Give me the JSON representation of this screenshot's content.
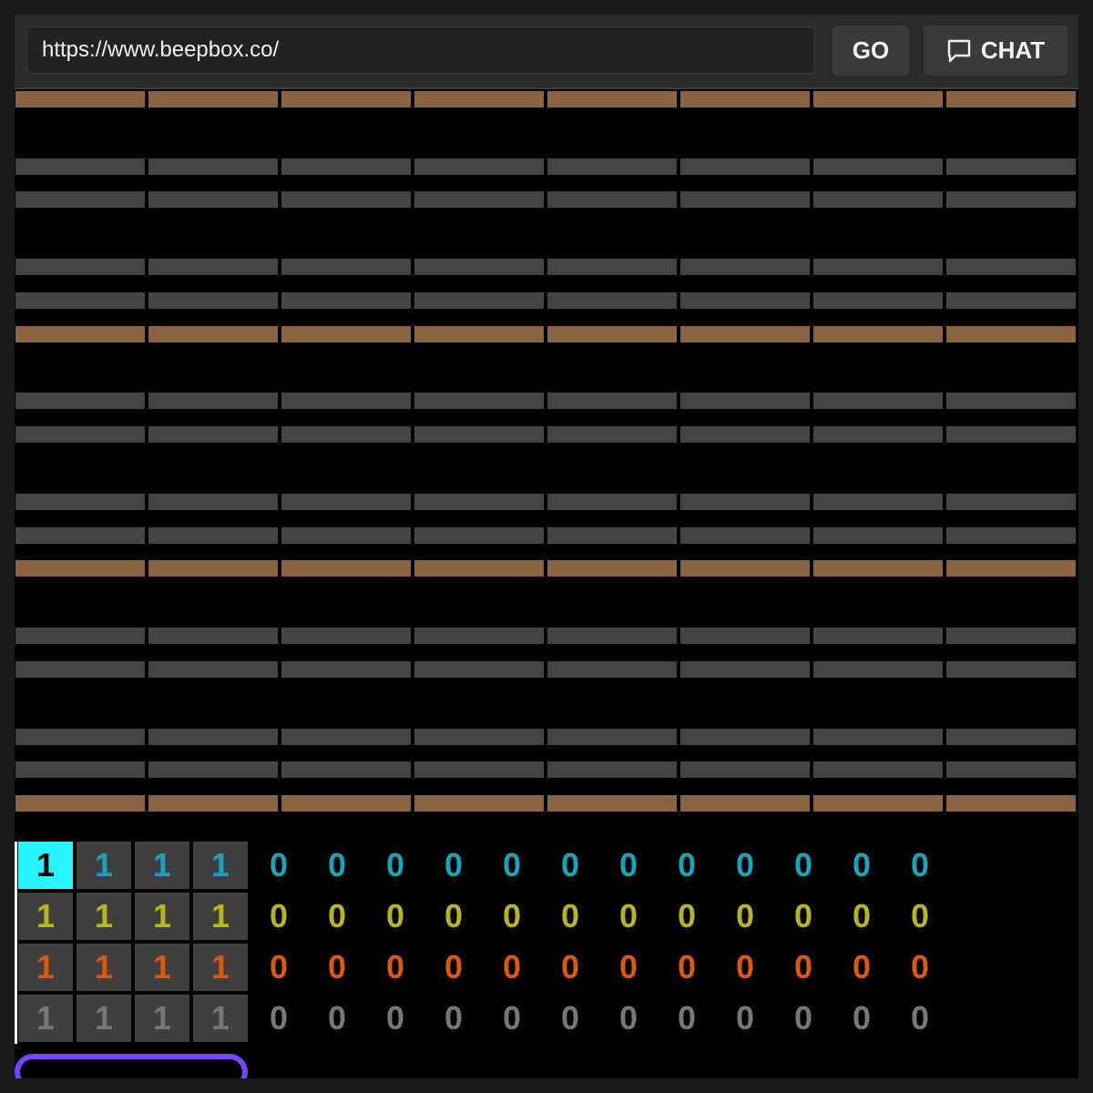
{
  "browser": {
    "url_value": "https://www.beepbox.co/",
    "go_label": "GO",
    "chat_label": "CHAT",
    "chat_icon": "speech-bubble-icon"
  },
  "pattern_editor": {
    "rows": [
      {
        "kind": "accent"
      },
      {
        "kind": "empty"
      },
      {
        "kind": "gray"
      },
      {
        "kind": "gray"
      },
      {
        "kind": "empty"
      },
      {
        "kind": "gray"
      },
      {
        "kind": "gray"
      },
      {
        "kind": "accent"
      },
      {
        "kind": "empty"
      },
      {
        "kind": "gray"
      },
      {
        "kind": "gray"
      },
      {
        "kind": "empty"
      },
      {
        "kind": "gray"
      },
      {
        "kind": "gray"
      },
      {
        "kind": "accent"
      },
      {
        "kind": "empty"
      },
      {
        "kind": "gray"
      },
      {
        "kind": "gray"
      },
      {
        "kind": "empty"
      },
      {
        "kind": "gray"
      },
      {
        "kind": "gray"
      },
      {
        "kind": "accent"
      }
    ],
    "bars_per_row": 8,
    "colors": {
      "gray": "#444444",
      "accent": "#8a6440"
    }
  },
  "track_editor": {
    "selected": {
      "channel": 0,
      "bar": 0
    },
    "channels": [
      {
        "color": "#1aa3b8",
        "cells": [
          "1",
          "1",
          "1",
          "1",
          "0",
          "0",
          "0",
          "0",
          "0",
          "0",
          "0",
          "0",
          "0",
          "0",
          "0",
          "0"
        ]
      },
      {
        "color": "#b5b51e",
        "cells": [
          "1",
          "1",
          "1",
          "1",
          "0",
          "0",
          "0",
          "0",
          "0",
          "0",
          "0",
          "0",
          "0",
          "0",
          "0",
          "0"
        ]
      },
      {
        "color": "#d9590f",
        "cells": [
          "1",
          "1",
          "1",
          "1",
          "0",
          "0",
          "0",
          "0",
          "0",
          "0",
          "0",
          "0",
          "0",
          "0",
          "0",
          "0"
        ]
      },
      {
        "color": "#777777",
        "cells": [
          "1",
          "1",
          "1",
          "1",
          "0",
          "0",
          "0",
          "0",
          "0",
          "0",
          "0",
          "0",
          "0",
          "0",
          "0",
          "0"
        ]
      }
    ],
    "selected_color": "#25f3ff",
    "add_button_color": "#7744ff"
  }
}
